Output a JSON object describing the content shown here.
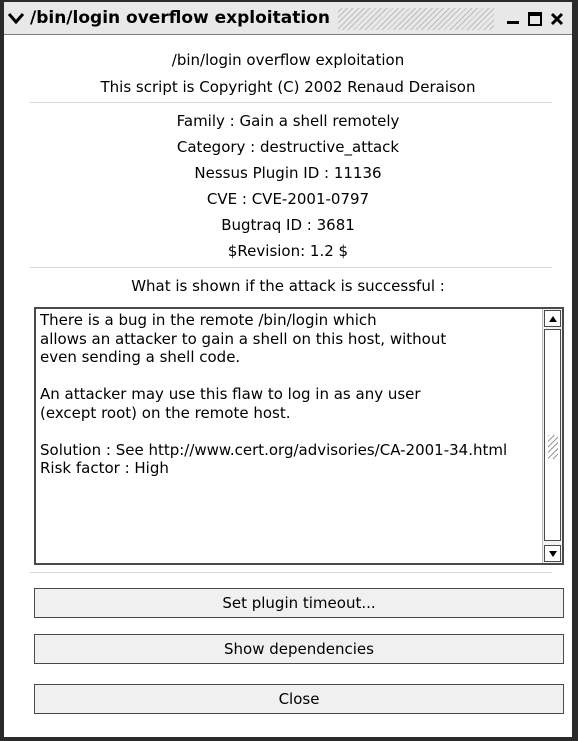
{
  "window": {
    "title": "/bin/login overflow exploitation"
  },
  "header": {
    "name": "/bin/login overflow exploitation",
    "copyright": "This script is Copyright (C) 2002 Renaud Deraison"
  },
  "info": {
    "family": "Family : Gain a shell remotely",
    "category": "Category : destructive_attack",
    "plugin_id": "Nessus Plugin ID : 11136",
    "cve": "CVE : CVE-2001-0797",
    "bugtraq": "Bugtraq ID : 3681",
    "revision": "$Revision: 1.2 $"
  },
  "description": {
    "label": "What is shown if the attack is successful :",
    "text": "There is a bug in the remote /bin/login which\nallows an attacker to gain a shell on this host, without\neven sending a shell code.\n\nAn attacker may use this flaw to log in as any user\n(except root) on the remote host.\n\nSolution : See http://www.cert.org/advisories/CA-2001-34.html\nRisk factor : High"
  },
  "buttons": {
    "timeout": "Set plugin timeout...",
    "dependencies": "Show dependencies",
    "close": "Close"
  }
}
